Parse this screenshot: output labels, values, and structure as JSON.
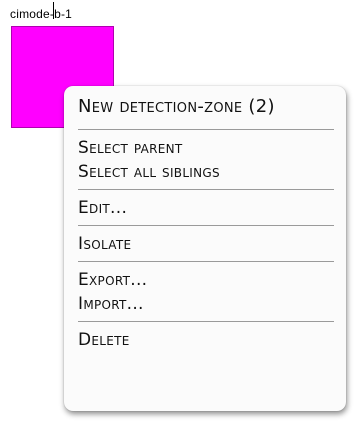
{
  "node": {
    "label": "cimode-b-1",
    "color": "#ff00ff"
  },
  "menu": {
    "groups": [
      [
        "New detection-zone (2)"
      ],
      [
        "Select parent",
        "Select all siblings"
      ],
      [
        "Edit..."
      ],
      [
        "Isolate"
      ],
      [
        "Export...",
        "Import..."
      ],
      [
        "Delete"
      ]
    ]
  }
}
